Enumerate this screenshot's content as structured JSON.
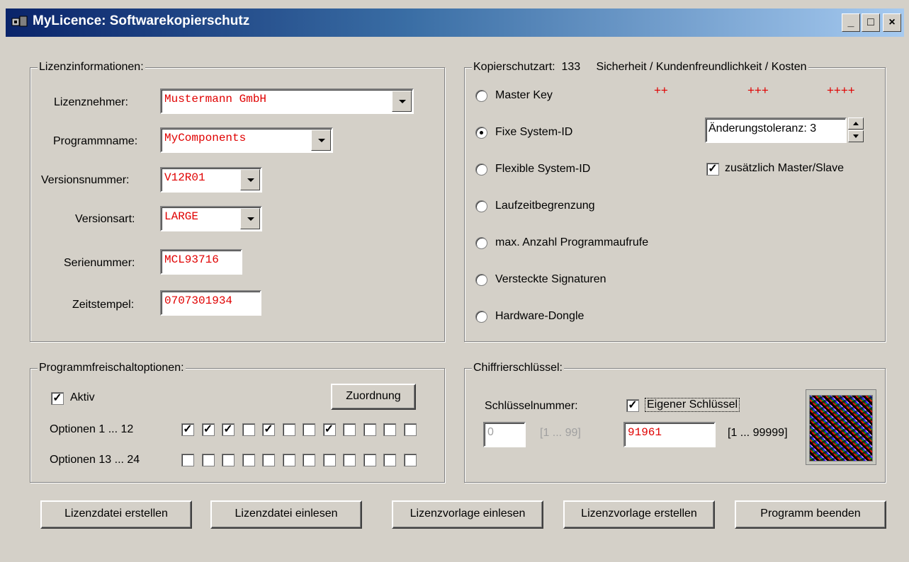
{
  "window": {
    "title": "MyLicence: Softwarekopierschutz",
    "min": "_",
    "max": "□",
    "close": "×"
  },
  "license_info": {
    "legend": "Lizenzinformationen:",
    "licensee_label": "Lizenznehmer:",
    "licensee_value": "Mustermann GmbH",
    "program_label": "Programmname:",
    "program_value": "MyComponents",
    "version_label": "Versionsnummer:",
    "version_value": "V12R01",
    "edition_label": "Versionsart:",
    "edition_value": "LARGE",
    "serial_label": "Serienummer:",
    "serial_value": "MCL93716",
    "timestamp_label": "Zeitstempel:",
    "timestamp_value": "0707301934"
  },
  "protection": {
    "legend_prefix": "Kopierschutzart:",
    "legend_code": "133",
    "legend_criteria": "Sicherheit / Kundenfreundlichkeit / Kosten",
    "ratings": [
      "++",
      "+++",
      "++++"
    ],
    "options": [
      {
        "label": "Master Key",
        "selected": false
      },
      {
        "label": "Fixe System-ID",
        "selected": true
      },
      {
        "label": "Flexible System-ID",
        "selected": false
      },
      {
        "label": "Laufzeitbegrenzung",
        "selected": false
      },
      {
        "label": "max. Anzahl Programmaufrufe",
        "selected": false
      },
      {
        "label": "Versteckte Signaturen",
        "selected": false
      },
      {
        "label": "Hardware-Dongle",
        "selected": false
      }
    ],
    "tolerance": "Änderungstoleranz: 3",
    "master_slave_label": "zusätzlich Master/Slave",
    "master_slave_checked": true
  },
  "unlock": {
    "legend": "Programmfreischaltoptionen:",
    "active_label": "Aktiv",
    "active_checked": true,
    "assign_button": "Zuordnung",
    "row1_label": "Optionen 1 ... 12",
    "row2_label": "Optionen 13 ... 24",
    "row1": [
      true,
      true,
      true,
      false,
      true,
      false,
      false,
      true,
      false,
      false,
      false,
      false
    ],
    "row2": [
      false,
      false,
      false,
      false,
      false,
      false,
      false,
      false,
      false,
      false,
      false,
      false
    ]
  },
  "cipher": {
    "legend": "Chiffrierschlüssel:",
    "keynum_label": "Schlüsselnummer:",
    "own_key_label": "Eigener Schlüssel",
    "own_key_checked": true,
    "keynum_value": "0",
    "keynum_range": "[1 ... 99]",
    "own_key_value": "91961",
    "own_key_range": "[1 ... 99999]"
  },
  "buttons": {
    "create_license": "Lizenzdatei erstellen",
    "read_license": "Lizenzdatei einlesen",
    "read_template": "Lizenzvorlage einlesen",
    "create_template": "Lizenzvorlage erstellen",
    "exit": "Programm beenden"
  }
}
